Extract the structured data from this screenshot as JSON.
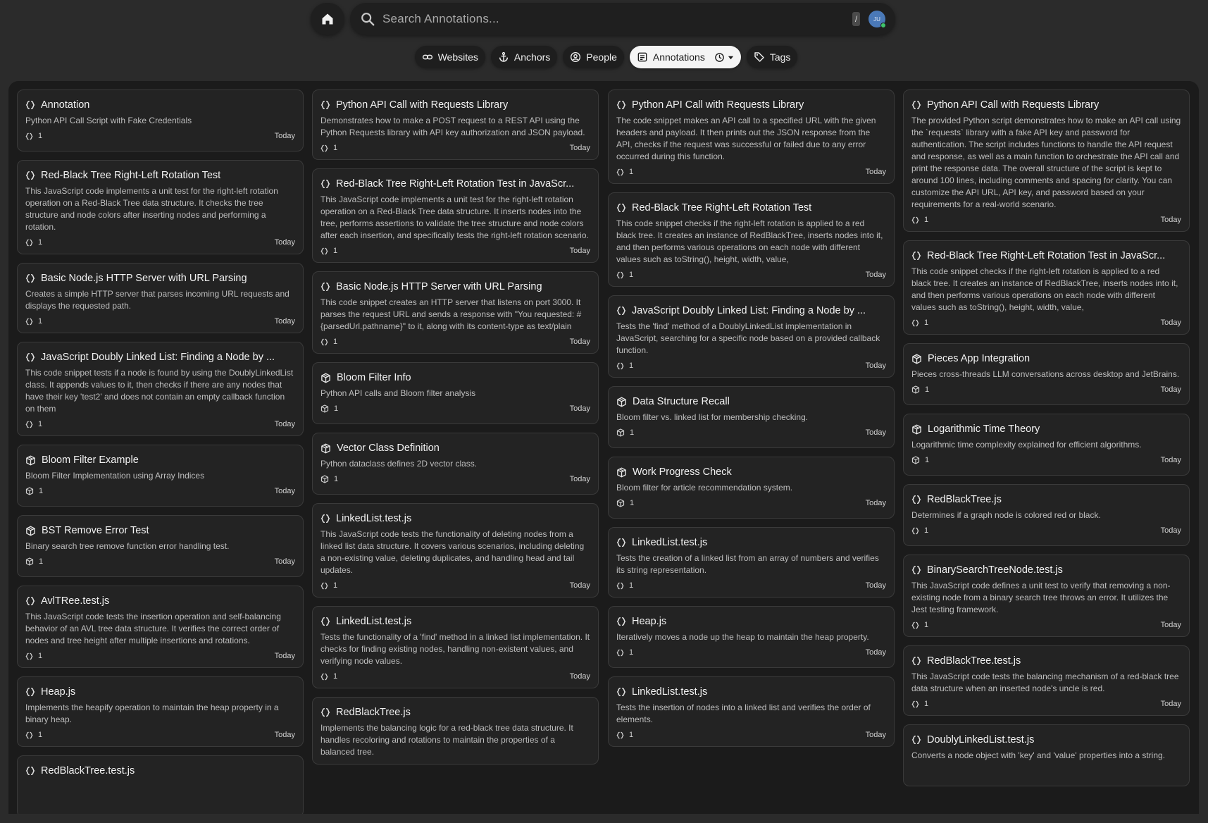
{
  "search": {
    "placeholder": "Search Annotations...",
    "shortcut": "/",
    "avatar_initials": "JU"
  },
  "filters": [
    {
      "label": "Websites",
      "icon": "link-icon",
      "active": false
    },
    {
      "label": "Anchors",
      "icon": "anchor-icon",
      "active": false
    },
    {
      "label": "People",
      "icon": "person-icon",
      "active": false
    },
    {
      "label": "Annotations",
      "icon": "note-icon",
      "active": true
    },
    {
      "label": "Tags",
      "icon": "tag-icon",
      "active": false
    }
  ],
  "columns": [
    [
      {
        "icon": "code",
        "title": "Annotation",
        "desc": "Python API Call Script with Fake Credentials",
        "count": "1",
        "date": "Today"
      },
      {
        "icon": "code",
        "title": "Red-Black Tree Right-Left Rotation Test",
        "desc": "This JavaScript code implements a unit test for the right-left rotation operation on a Red-Black Tree data structure. It checks the tree structure and node colors after inserting nodes and performing a rotation.",
        "count": "1",
        "date": "Today"
      },
      {
        "icon": "code",
        "title": "Basic Node.js HTTP Server with URL Parsing",
        "desc": "Creates a simple HTTP server that parses incoming URL requests and displays the requested path.",
        "count": "1",
        "date": "Today"
      },
      {
        "icon": "code",
        "title": "JavaScript Doubly Linked List: Finding a Node by ...",
        "desc": "This code snippet tests if a node is found by using the DoublyLinkedList class. It appends values to it, then checks if there are any nodes that have their key 'test2' and does not contain an empty callback function on them",
        "count": "1",
        "date": "Today"
      },
      {
        "icon": "cube",
        "title": "Bloom Filter Example",
        "desc": "Bloom Filter Implementation using Array Indices",
        "count": "1",
        "date": "Today"
      },
      {
        "icon": "cube",
        "title": "BST Remove Error Test",
        "desc": "Binary search tree remove function error handling test.",
        "count": "1",
        "date": "Today"
      },
      {
        "icon": "code",
        "title": "AvlTRee.test.js",
        "desc": "This JavaScript code tests the insertion operation and self-balancing behavior of an AVL tree data structure. It verifies the correct order of nodes and tree height after multiple insertions and rotations.",
        "count": "1",
        "date": "Today"
      },
      {
        "icon": "code",
        "title": "Heap.js",
        "desc": "Implements the heapify operation to maintain the heap property in a binary heap.",
        "count": "1",
        "date": "Today"
      },
      {
        "icon": "code",
        "title": "RedBlackTree.test.js",
        "desc": "",
        "count": "",
        "date": ""
      }
    ],
    [
      {
        "icon": "code",
        "title": "Python API Call with Requests Library",
        "desc": "Demonstrates how to make a POST request to a REST API using the Python Requests library with API key authorization and JSON payload.",
        "count": "1",
        "date": "Today"
      },
      {
        "icon": "code",
        "title": "Red-Black Tree Right-Left Rotation Test in JavaScr...",
        "desc": "This JavaScript code implements a unit test for the right-left rotation operation on a Red-Black Tree data structure. It inserts nodes into the tree, performs assertions to validate the tree structure and node colors after each insertion, and specifically tests the right-left rotation scenario.",
        "count": "1",
        "date": "Today"
      },
      {
        "icon": "code",
        "title": "Basic Node.js HTTP Server with URL Parsing",
        "desc": "This code snippet creates an HTTP server that listens on port 3000. It parses the request URL and sends a response with \"You requested: #{parsedUrl.pathname}\" to it, along with its content-type as text/plain",
        "count": "1",
        "date": "Today"
      },
      {
        "icon": "cube",
        "title": "Bloom Filter Info",
        "desc": "Python API calls and Bloom filter analysis",
        "count": "1",
        "date": "Today"
      },
      {
        "icon": "cube",
        "title": "Vector Class Definition",
        "desc": "Python dataclass defines 2D vector class.",
        "count": "1",
        "date": "Today"
      },
      {
        "icon": "code",
        "title": "LinkedList.test.js",
        "desc": "This JavaScript code tests the functionality of deleting nodes from a linked list data structure. It covers various scenarios, including deleting a non-existing value, deleting duplicates, and handling head and tail updates.",
        "count": "1",
        "date": "Today"
      },
      {
        "icon": "code",
        "title": "LinkedList.test.js",
        "desc": "Tests the functionality of a 'find' method in a linked list implementation. It checks for finding existing nodes, handling non-existent values, and verifying node values.",
        "count": "1",
        "date": "Today"
      },
      {
        "icon": "code",
        "title": "RedBlackTree.js",
        "desc": "Implements the balancing logic for a red-black tree data structure. It handles recoloring and rotations to maintain the properties of a balanced tree.",
        "count": "",
        "date": ""
      }
    ],
    [
      {
        "icon": "code",
        "title": "Python API Call with Requests Library",
        "desc": "The code snippet makes an API call to a specified URL with the given headers and payload. It then prints out the JSON response from the API, checks if the request was successful or failed due to any error occurred during this function.",
        "count": "1",
        "date": "Today"
      },
      {
        "icon": "code",
        "title": "Red-Black Tree Right-Left Rotation Test",
        "desc": "This code snippet checks if the right-left rotation is applied to a red black tree. It creates an instance of RedBlackTree, inserts nodes into it, and then performs various operations on each node with different values such as toString(), height, width, value,",
        "count": "1",
        "date": "Today"
      },
      {
        "icon": "code",
        "title": "JavaScript Doubly Linked List: Finding a Node by ...",
        "desc": "Tests the 'find' method of a DoublyLinkedList implementation in JavaScript, searching for a specific node based on a provided callback function.",
        "count": "1",
        "date": "Today"
      },
      {
        "icon": "cube",
        "title": "Data Structure Recall",
        "desc": "Bloom filter vs. linked list for membership checking.",
        "count": "1",
        "date": "Today"
      },
      {
        "icon": "cube",
        "title": "Work Progress Check",
        "desc": "Bloom filter for article recommendation system.",
        "count": "1",
        "date": "Today"
      },
      {
        "icon": "code",
        "title": "LinkedList.test.js",
        "desc": "Tests the creation of a linked list from an array of numbers and verifies its string representation.",
        "count": "1",
        "date": "Today"
      },
      {
        "icon": "code",
        "title": "Heap.js",
        "desc": "Iteratively moves a node up the heap to maintain the heap property.",
        "count": "1",
        "date": "Today"
      },
      {
        "icon": "code",
        "title": "LinkedList.test.js",
        "desc": "Tests the insertion of nodes into a linked list and verifies the order of elements.",
        "count": "1",
        "date": "Today"
      }
    ],
    [
      {
        "icon": "code",
        "title": "Python API Call with Requests Library",
        "desc": "The provided Python script demonstrates how to make an API call using the `requests` library with a fake API key and password for authentication. The script includes functions to handle the API request and response, as well as a main function to orchestrate the API call and print the response data. The overall structure of the script is kept to around 100 lines, including comments and spacing for clarity. You can customize the API URL, API key, and password based on your requirements for a real-world scenario.",
        "count": "1",
        "date": "Today"
      },
      {
        "icon": "code",
        "title": "Red-Black Tree Right-Left Rotation Test in JavaScr...",
        "desc": "This code snippet checks if the right-left rotation is applied to a red black tree. It creates an instance of RedBlackTree, inserts nodes into it, and then performs various operations on each node with different values such as toString(), height, width, value,",
        "count": "1",
        "date": "Today"
      },
      {
        "icon": "cube",
        "title": "Pieces App Integration",
        "desc": "Pieces cross-threads LLM conversations across desktop and JetBrains.",
        "count": "1",
        "date": "Today"
      },
      {
        "icon": "cube",
        "title": "Logarithmic Time Theory",
        "desc": "Logarithmic time complexity explained for efficient algorithms.",
        "count": "1",
        "date": "Today"
      },
      {
        "icon": "code",
        "title": "RedBlackTree.js",
        "desc": "Determines if a graph node is colored red or black.",
        "count": "1",
        "date": "Today"
      },
      {
        "icon": "code",
        "title": "BinarySearchTreeNode.test.js",
        "desc": "This JavaScript code defines a unit test to verify that removing a non-existing node from a binary search tree throws an error. It utilizes the Jest testing framework.",
        "count": "1",
        "date": "Today"
      },
      {
        "icon": "code",
        "title": "RedBlackTree.test.js",
        "desc": "This JavaScript code tests the balancing mechanism of a red-black tree data structure when an inserted node's uncle is red.",
        "count": "1",
        "date": "Today"
      },
      {
        "icon": "code",
        "title": "DoublyLinkedList.test.js",
        "desc": "Converts a node object with 'key' and 'value' properties into a string.",
        "count": "",
        "date": ""
      }
    ]
  ]
}
